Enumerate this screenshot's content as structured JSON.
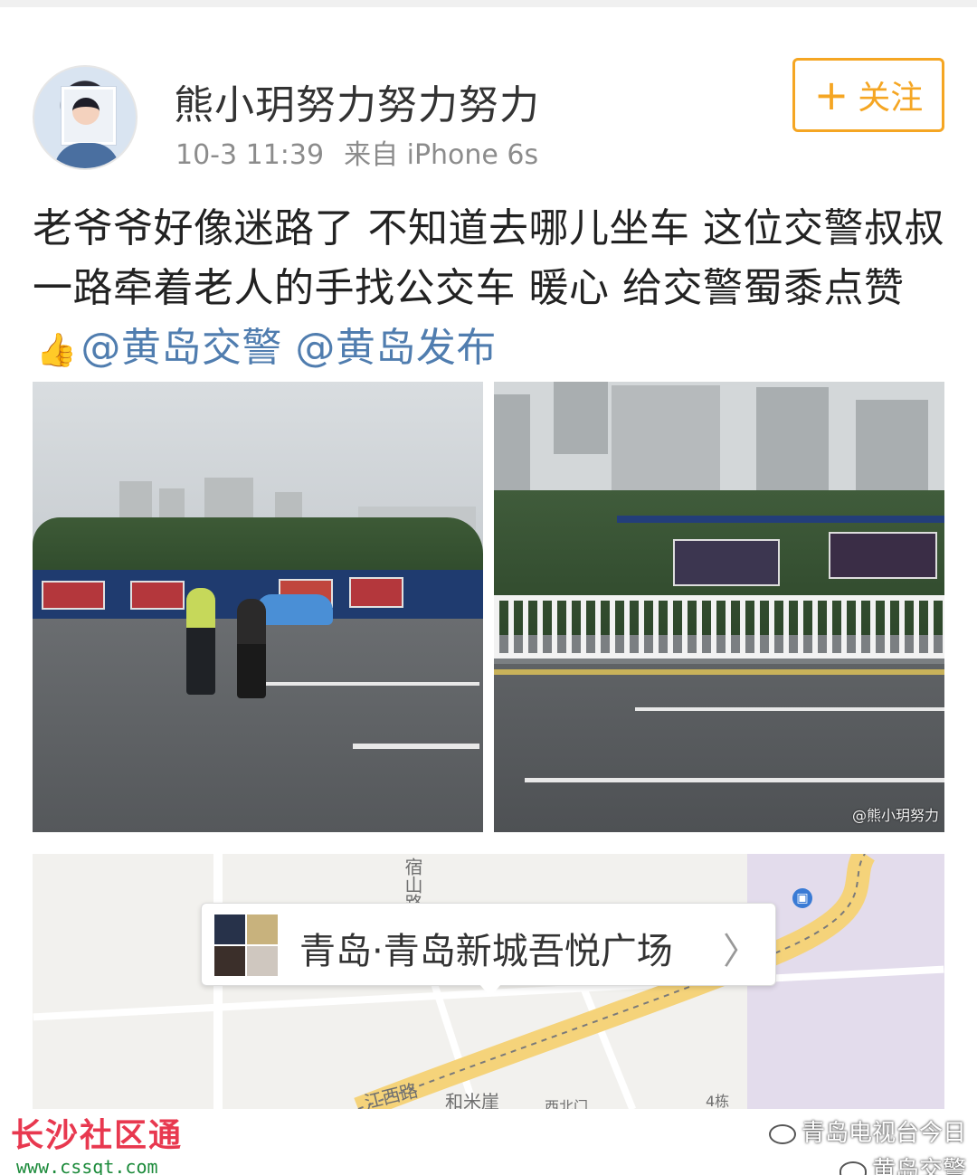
{
  "post": {
    "username": "熊小玥努力努力努力",
    "time": "10-3 11:39",
    "source": "来自 iPhone 6s",
    "follow_label": "关注",
    "follow_icon": "+",
    "text_main": "老爷爷好像迷路了 不知道去哪儿坐车 这位交警叔叔一路牵着老人的手找公交车  暖心 给交警蜀黍点赞",
    "thumbs_emoji": "👍",
    "mentions": [
      "@黄岛交警",
      "@黄岛发布"
    ],
    "photo_watermark": "@熊小玥努力"
  },
  "location": {
    "name": "青岛·青岛新城吾悦广场",
    "arrow": "〉",
    "map_labels": [
      "宿山路",
      "江西路",
      "和米崖",
      "西北门",
      "4栋"
    ]
  },
  "watermarks": {
    "left_title": "长沙社区通",
    "left_url": "www.cssqt.com",
    "right_wechat": "青岛电视台今日",
    "right_weibo": "黄岛交警"
  },
  "colors": {
    "accent_follow": "#f5a623",
    "mention": "#507daf",
    "wm_red": "#e8384f",
    "wm_green": "#1b8a3a"
  }
}
